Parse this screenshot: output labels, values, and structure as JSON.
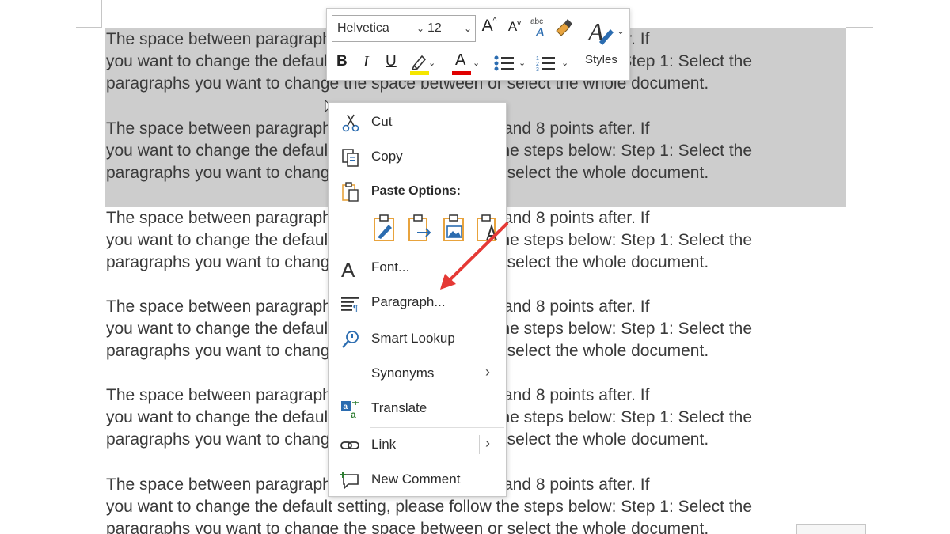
{
  "document": {
    "line1": "The space between paragraphs by default is 0 before and 8 points after. If",
    "line2": "you want to change the default setting, please follow the steps below: Step 1: Select the",
    "line3": "paragraphs you want to change the space between or select the whole document."
  },
  "mini_toolbar": {
    "font_name": "Helvetica",
    "font_size": "12",
    "grow_font_label": "A",
    "shrink_font_label": "A",
    "bold_label": "B",
    "italic_label": "I",
    "underline_label": "U",
    "font_color_label": "A",
    "styles_label": "Styles",
    "highlight_color": "#f5e600",
    "font_color": "#e00000"
  },
  "context_menu": {
    "cut_label": "Cut",
    "copy_label": "Copy",
    "paste_options_label": "Paste Options:",
    "font_label": "Font...",
    "paragraph_label": "Paragraph...",
    "smart_lookup_label": "Smart Lookup",
    "synonyms_label": "Synonyms",
    "translate_label": "Translate",
    "link_label": "Link",
    "new_comment_label": "New Comment"
  },
  "colors": {
    "selection": "#cdcdcd",
    "annotation_arrow": "#e53935",
    "icon_blue": "#2b6cb0",
    "icon_orange": "#e8a33d"
  }
}
